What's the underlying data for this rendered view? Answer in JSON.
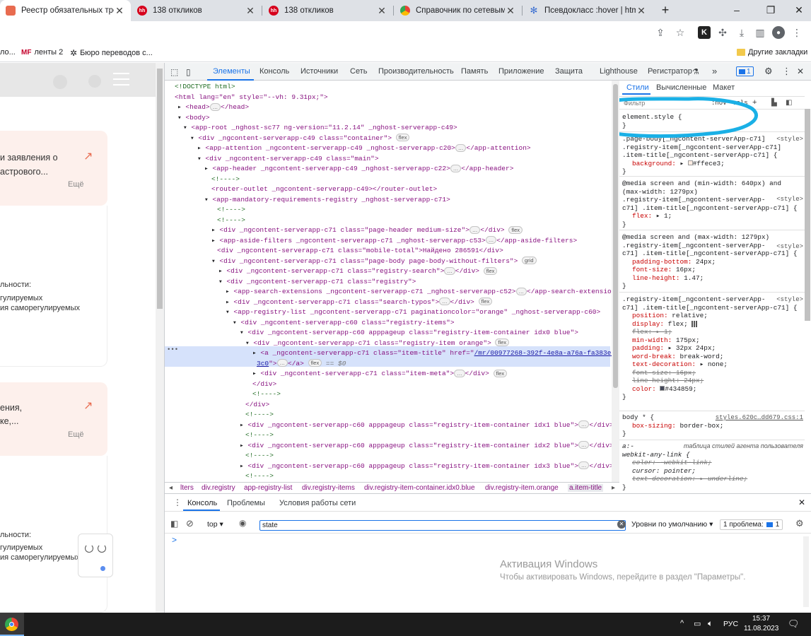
{
  "tabs": [
    {
      "title": "Реестр обязательных требов",
      "favicon": "registry-icon"
    },
    {
      "title": "138 откликов",
      "favicon": "hh-icon"
    },
    {
      "title": "138 откликов",
      "favicon": "hh-icon"
    },
    {
      "title": "Справочник по сетевым фу",
      "favicon": "chrome-icon"
    },
    {
      "title": "Псевдокласс :hover | htmlbo",
      "favicon": "htmlbook-icon"
    }
  ],
  "bookmarks": {
    "b1": "ло...",
    "b2_prefix": "MF",
    "b2": "ленты 2",
    "b3": "Бюро переводов с...",
    "other": "Другие закладки"
  },
  "page": {
    "card1_line1": "и заявления о",
    "card1_line2": "астрового...",
    "card1_more": "Ещё",
    "card2_line1": "ения,",
    "card2_line2": "ке,...",
    "card2_more": "Ещё",
    "block1_a": "льности:",
    "block1_b": "гулируемых",
    "block1_c": "ия саморегулируемых",
    "block2_a": "льности:",
    "block2_b": "гулируемых",
    "block2_c": "ия саморегулируемых"
  },
  "devtools": {
    "tabs": [
      "Элементы",
      "Консоль",
      "Источники",
      "Сеть",
      "Производительность",
      "Память",
      "Приложение",
      "Защита",
      "Lighthouse",
      "Регистратор"
    ],
    "issues_count": "1",
    "elements": [
      "<!DOCTYPE html>",
      "<html lang=\"en\" style=\"--vh: 9.31px;\">",
      "<head>",
      "</head>",
      "<body>",
      "<app-root _nghost-sc77 ng-version=\"11.2.14\" _nghost-serverapp-c49>",
      "<div _ngcontent-serverapp-c49 class=\"container\">",
      "<app-attention _ngcontent-serverapp-c49 _nghost-serverapp-c20>",
      "</app-attention>",
      "<div _ngcontent-serverapp-c49 class=\"main\">",
      "<app-header _ngcontent-serverapp-c49 _nghost-serverapp-c22>",
      "</app-header>",
      "<!---->",
      "<router-outlet _ngcontent-serverapp-c49></router-outlet>",
      "<app-mandatory-requirements-registry _nghost-serverapp-c71>",
      "<!---->",
      "<!---->",
      "<div _ngcontent-serverapp-c71 class=\"page-header medium-size\">",
      "</div>",
      "<app-aside-filters _ngcontent-serverapp-c71 _nghost-serverapp-c53>",
      "</app-aside-filters>",
      "<div _ngcontent-serverapp-c71 class=\"mobile-total\">Найдено 286591</div>",
      "<div _ngcontent-serverapp-c71 class=\"page-body page-body-without-filters\">",
      "<div _ngcontent-serverapp-c71 class=\"registry-search\">",
      "</div>",
      "<div _ngcontent-serverapp-c71 class=\"registry\">",
      "<app-search-extensions _ngcontent-serverapp-c71 _nghost-serverapp-c52>",
      "</app-search-extensions>",
      "<div _ngcontent-serverapp-c71 class=\"search-typos\">",
      "</div>",
      "<app-registry-list _ngcontent-serverapp-c71 paginationcolor=\"orange\" _nghost-serverapp-c60>",
      "<div _ngcontent-serverapp-c60 class=\"registry-items\">",
      "<div _ngcontent-serverapp-c60 apppageup class=\"registry-item-container idx0 blue\">",
      "<div _ngcontent-serverapp-c71 class=\"registry-item orange\">",
      "<a _ngcontent-serverapp-c71 class=\"item-title\" href=\"",
      "/mr/00977268-392f-4e8a-a76a-fa383ea33",
      "3c0",
      "\">",
      "</a>",
      "== $0",
      "<div _ngcontent-serverapp-c71 class=\"item-meta\">",
      "</div>",
      "</div>",
      "<!---->",
      "</div>",
      "<!---->",
      "<div _ngcontent-serverapp-c60 apppageup class=\"registry-item-container idx1 blue\">",
      "</div>",
      "<!---->",
      "<div _ngcontent-serverapp-c60 apppageup class=\"registry-item-container idx2 blue\">",
      "</div>",
      "<!---->",
      "<div _ngcontent-serverapp-c60 apppageup class=\"registry-item-container idx3 blue\">",
      "</div>",
      "<!---->"
    ],
    "badges": {
      "flex": "flex",
      "grid": "grid"
    },
    "breadcrumbs": [
      "lters",
      "div.registry",
      "app-registry-list",
      "div.registry-items",
      "div.registry-item-container.idx0.blue",
      "div.registry-item.orange",
      "a.item-title"
    ],
    "styles": {
      "tabs": [
        "Стили",
        "Вычисленные",
        "Макет"
      ],
      "filter_placeholder": "Фильтр",
      "hov": ":hov",
      "cls": ".cls",
      "element_style": "element.style {",
      "close_brace": "}",
      "rule1_sel": ".page-body[_ngcontent-serverApp-c71]",
      "rule1_sel2": ".registry-item[_ngcontent-serverApp-c71]",
      "rule1_sel3": ".item-title[_ngcontent-serverApp-c71] {",
      "rule1_prop": "background:",
      "rule1_val": "#ffece3;",
      "style_src": "<style>",
      "rule2_media": "@media screen and (min-width: 640px) and",
      "rule2_media2": "(max-width: 1279px)",
      "rule2_sel": ".registry-item[_ngcontent-serverApp-",
      "rule2_sel2": "c71] .item-title[_ngcontent-serverApp-c71] {",
      "rule2_prop": "flex:",
      "rule2_val": "1;",
      "rule3_media": "@media screen and (max-width: 1279px)",
      "rule3_sel": ".registry-item[_ngcontent-serverApp-",
      "rule3_sel2": "c71] .item-title[_ngcontent-serverApp-c71] {",
      "rule3_p1": "padding-bottom:",
      "rule3_v1": "24px;",
      "rule3_p2": "font-size:",
      "rule3_v2": "16px;",
      "rule3_p3": "line-height:",
      "rule3_v3": "1.47;",
      "rule4_sel": ".registry-item[_ngcontent-serverApp-",
      "rule4_sel2": "c71] .item-title[_ngcontent-serverApp-c71] {",
      "rule4_props": [
        [
          "position:",
          "relative;"
        ],
        [
          "display:",
          "flex;"
        ],
        [
          "flex:",
          "1;"
        ],
        [
          "min-width:",
          "175px;"
        ],
        [
          "padding:",
          "32px 24px;"
        ],
        [
          "word-break:",
          "break-word;"
        ],
        [
          "text-decoration:",
          "none;"
        ],
        [
          "font-size:",
          "16px;"
        ],
        [
          "line-height:",
          "24px;"
        ],
        [
          "color:",
          "#434859;"
        ]
      ],
      "rule5_sel": "body * {",
      "rule5_src": "styles.620c…dd679.css:1",
      "rule5_prop": "box-sizing:",
      "rule5_val": "border-box;",
      "rule6_sel": "a:-",
      "rule6_src": "таблица стилей агента пользователя",
      "rule6_sel2": "webkit-any-link {",
      "rule6_p1": "color:",
      "rule6_v1": "-webkit-link;",
      "rule6_p2": "cursor:",
      "rule6_v2": "pointer;",
      "rule6_p3": "text-decoration:",
      "rule6_v3": "underline;"
    },
    "console": {
      "tabs": [
        "Консоль",
        "Проблемы",
        "Условия работы сети"
      ],
      "context": "top",
      "filter_value": "state",
      "levels": "Уровни по умолчанию",
      "issues": "1 проблема:",
      "issues_count": "1",
      "prompt": ">"
    }
  },
  "watermark": {
    "line1": "Активация Windows",
    "line2": "Чтобы активировать Windows, перейдите в раздел \"Параметры\"."
  },
  "taskbar": {
    "lang": "РУС",
    "time": "15:37",
    "date": "11.08.2023"
  },
  "colors": {
    "annotation": "#1ab0e6",
    "accent": "#1a73e8",
    "pink_card": "#fdf0ec"
  }
}
